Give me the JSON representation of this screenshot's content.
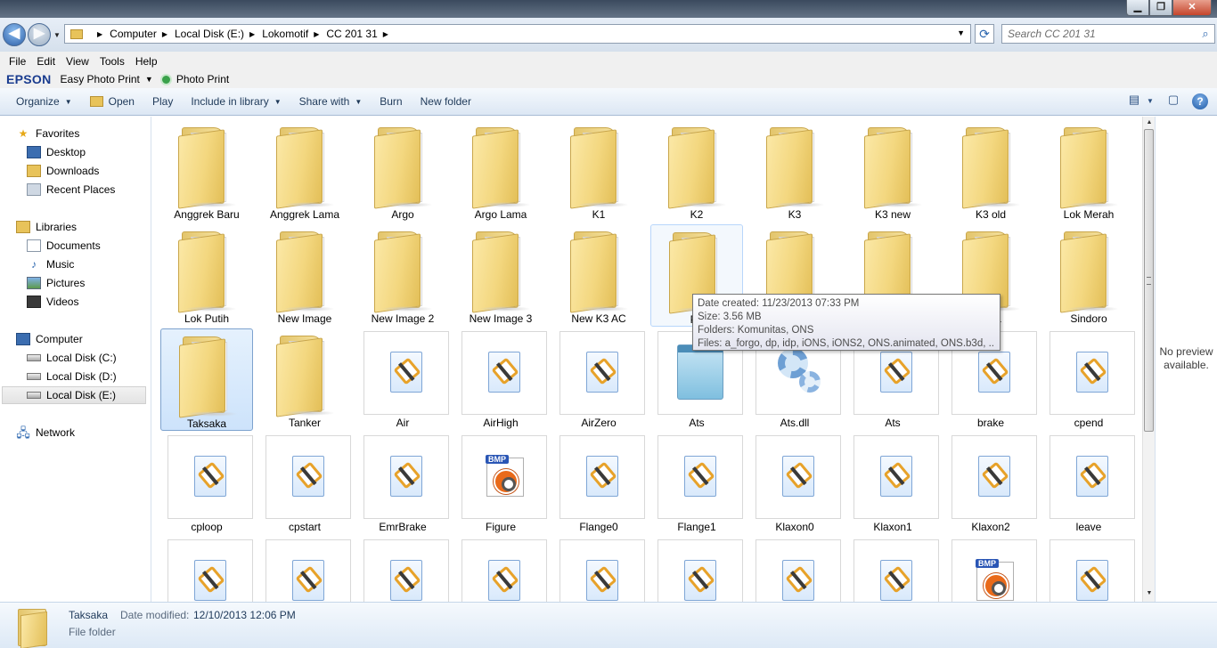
{
  "window": {
    "controls": [
      "minimize",
      "maximize",
      "close"
    ]
  },
  "address": {
    "crumbs": [
      "Computer",
      "Local Disk (E:)",
      "Lokomotif",
      "CC 201 31"
    ],
    "search_placeholder": "Search CC 201 31"
  },
  "menu": [
    "File",
    "Edit",
    "View",
    "Tools",
    "Help"
  ],
  "epson": {
    "brand": "EPSON",
    "easy_photo_print": "Easy Photo Print",
    "photo_print": "Photo Print"
  },
  "commands": {
    "organize": "Organize",
    "open": "Open",
    "play": "Play",
    "include": "Include in library",
    "share": "Share with",
    "burn": "Burn",
    "new_folder": "New folder"
  },
  "sidebar": {
    "favorites": "Favorites",
    "fav_items": [
      "Desktop",
      "Downloads",
      "Recent Places"
    ],
    "libraries": "Libraries",
    "lib_items": [
      "Documents",
      "Music",
      "Pictures",
      "Videos"
    ],
    "computer": "Computer",
    "drives": [
      "Local Disk (C:)",
      "Local Disk (D:)",
      "Local Disk (E:)"
    ],
    "network": "Network"
  },
  "files": [
    {
      "name": "Anggrek Baru",
      "type": "folder"
    },
    {
      "name": "Anggrek Lama",
      "type": "folder"
    },
    {
      "name": "Argo",
      "type": "folder"
    },
    {
      "name": "Argo Lama",
      "type": "folder"
    },
    {
      "name": "K1",
      "type": "folder"
    },
    {
      "name": "K2",
      "type": "folder"
    },
    {
      "name": "K3",
      "type": "folder"
    },
    {
      "name": "K3 new",
      "type": "folder"
    },
    {
      "name": "K3 old",
      "type": "folder"
    },
    {
      "name": "Lok Merah",
      "type": "folder"
    },
    {
      "name": "Lok Putih",
      "type": "folder"
    },
    {
      "name": "New Image",
      "type": "folder"
    },
    {
      "name": "New Image 2",
      "type": "folder"
    },
    {
      "name": "New Image 3",
      "type": "folder"
    },
    {
      "name": "New K3 AC",
      "type": "folder"
    },
    {
      "name": "Pa",
      "type": "folder"
    },
    {
      "name": "",
      "type": "folder"
    },
    {
      "name": "",
      "type": "folder"
    },
    {
      "name": "ama",
      "type": "folder"
    },
    {
      "name": "Sindoro",
      "type": "folder"
    },
    {
      "name": "Taksaka",
      "type": "folder"
    },
    {
      "name": "Tanker",
      "type": "folder"
    },
    {
      "name": "Air",
      "type": "sound"
    },
    {
      "name": "AirHigh",
      "type": "sound"
    },
    {
      "name": "AirZero",
      "type": "sound"
    },
    {
      "name": "Ats",
      "type": "notepad"
    },
    {
      "name": "Ats.dll",
      "type": "dll"
    },
    {
      "name": "Ats",
      "type": "sound"
    },
    {
      "name": "brake",
      "type": "sound"
    },
    {
      "name": "cpend",
      "type": "sound"
    },
    {
      "name": "cploop",
      "type": "sound"
    },
    {
      "name": "cpstart",
      "type": "sound"
    },
    {
      "name": "EmrBrake",
      "type": "sound"
    },
    {
      "name": "Figure",
      "type": "bmp"
    },
    {
      "name": "Flange0",
      "type": "sound"
    },
    {
      "name": "Flange1",
      "type": "sound"
    },
    {
      "name": "Klaxon0",
      "type": "sound"
    },
    {
      "name": "Klaxon1",
      "type": "sound"
    },
    {
      "name": "Klaxon2",
      "type": "sound"
    },
    {
      "name": "leave",
      "type": "sound"
    },
    {
      "name": "",
      "type": "sound"
    },
    {
      "name": "",
      "type": "sound"
    },
    {
      "name": "",
      "type": "sound"
    },
    {
      "name": "",
      "type": "sound"
    },
    {
      "name": "",
      "type": "sound"
    },
    {
      "name": "",
      "type": "sound"
    },
    {
      "name": "",
      "type": "sound"
    },
    {
      "name": "",
      "type": "sound"
    },
    {
      "name": "",
      "type": "bmp"
    },
    {
      "name": "",
      "type": "sound"
    }
  ],
  "selected_index": 20,
  "hover_index": 15,
  "tooltip": {
    "created": "Date created: 11/23/2013 07:33 PM",
    "size": "Size: 3.56 MB",
    "folders": "Folders: Komunitas, ONS",
    "files": "Files: a_forgo, dp, idp, iONS, iONS2, ONS.animated, ONS.b3d, ..."
  },
  "preview": {
    "text": "No preview available."
  },
  "details": {
    "name": "Taksaka",
    "modified_label": "Date modified:",
    "modified_value": "12/10/2013 12:06 PM",
    "type": "File folder"
  }
}
